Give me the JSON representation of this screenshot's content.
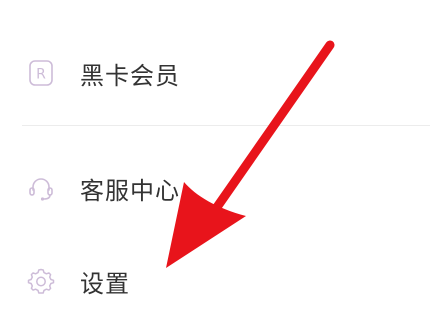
{
  "menu": {
    "items": [
      {
        "label": "黑卡会员",
        "icon": "black-card-r-icon"
      },
      {
        "label": "客服中心",
        "icon": "headset-icon"
      },
      {
        "label": "设置",
        "icon": "gear-icon"
      }
    ]
  },
  "annotation": {
    "arrow_color": "#e8141b",
    "icon_color": "#c9b9d6"
  }
}
